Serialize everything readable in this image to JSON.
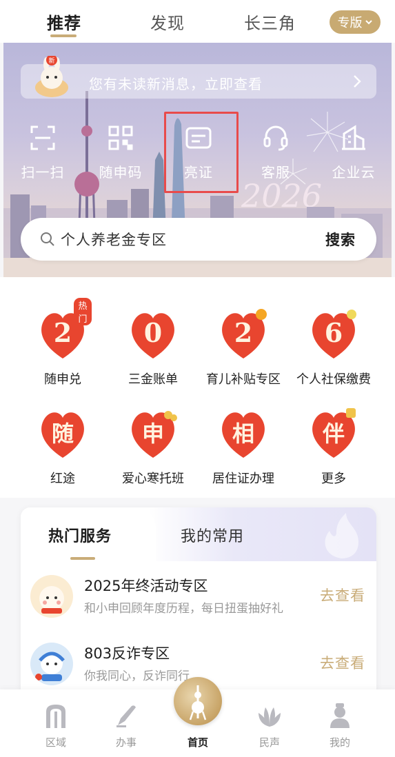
{
  "top_tabs": {
    "items": [
      {
        "label": "推荐",
        "active": true
      },
      {
        "label": "发现",
        "active": false
      },
      {
        "label": "长三角",
        "active": false
      }
    ],
    "edition_pill": "专版"
  },
  "hero": {
    "message_banner": "您有未读新消息，立即查看",
    "mascot_badge": "新",
    "decor_year": "2026",
    "quick_actions": [
      {
        "label": "扫一扫",
        "icon": "scan-icon"
      },
      {
        "label": "随申码",
        "icon": "qr-code-icon"
      },
      {
        "label": "亮证",
        "icon": "id-card-icon"
      },
      {
        "label": "客服",
        "icon": "headset-icon"
      },
      {
        "label": "企业云",
        "icon": "building-icon"
      }
    ],
    "search": {
      "placeholder": "个人养老金专区",
      "button": "搜索"
    }
  },
  "services": {
    "items": [
      {
        "label": "随申兑",
        "glyph": "2",
        "badge": "热门"
      },
      {
        "label": "三金账单",
        "glyph": "0"
      },
      {
        "label": "育儿补贴专区",
        "glyph": "2"
      },
      {
        "label": "个人社保缴费",
        "glyph": "6"
      },
      {
        "label": "红途",
        "glyph": "随"
      },
      {
        "label": "爱心寒托班",
        "glyph": "申"
      },
      {
        "label": "居住证办理",
        "glyph": "相"
      },
      {
        "label": "更多",
        "glyph": "伴"
      }
    ]
  },
  "hot_card": {
    "tabs": [
      {
        "label": "热门服务",
        "active": true
      },
      {
        "label": "我的常用",
        "active": false
      }
    ],
    "rows": [
      {
        "title": "2025年终活动专区",
        "subtitle": "和小申回顾年度历程，每日扭蛋抽好礼",
        "action": "去查看"
      },
      {
        "title": "803反诈专区",
        "subtitle": "你我同心，反诈同行",
        "action": "去查看"
      }
    ]
  },
  "bottom_nav": {
    "items": [
      {
        "label": "区域",
        "icon": "region-icon",
        "active": false
      },
      {
        "label": "办事",
        "icon": "pen-icon",
        "active": false
      },
      {
        "label": "首页",
        "icon": "home-tower-icon",
        "active": true
      },
      {
        "label": "民声",
        "icon": "magnolia-icon",
        "active": false
      },
      {
        "label": "我的",
        "icon": "profile-icon",
        "active": false
      }
    ]
  },
  "colors": {
    "gold_accent": "#c9ac78",
    "highlight_box": "#e84b4b",
    "service_red": "#e8452f"
  }
}
